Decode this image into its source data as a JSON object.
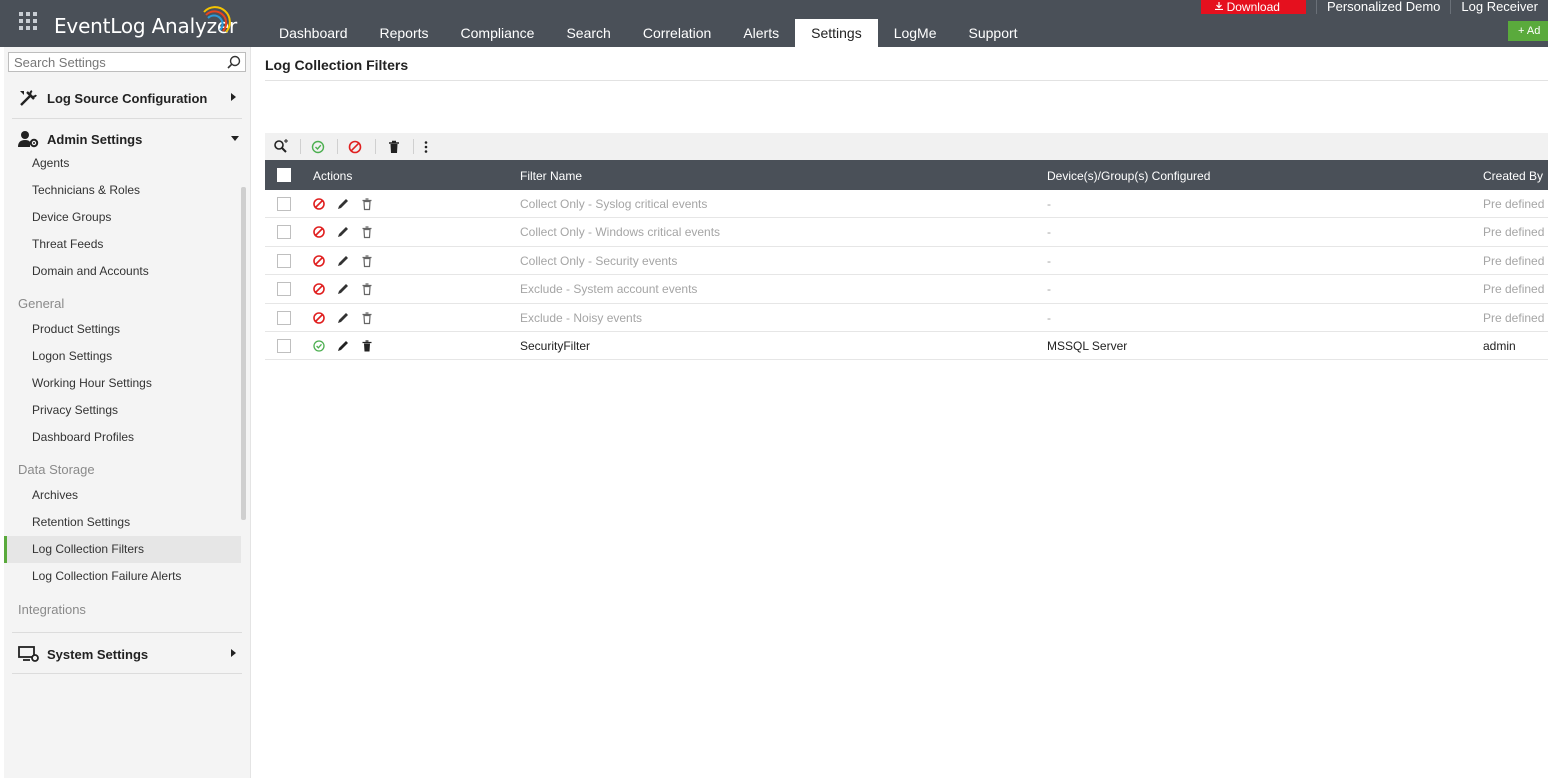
{
  "app": {
    "title": "EventLog Analyzer"
  },
  "nav": {
    "tabs": [
      {
        "label": "Dashboard"
      },
      {
        "label": "Reports"
      },
      {
        "label": "Compliance"
      },
      {
        "label": "Search"
      },
      {
        "label": "Correlation"
      },
      {
        "label": "Alerts"
      },
      {
        "label": "Settings"
      },
      {
        "label": "LogMe"
      },
      {
        "label": "Support"
      }
    ],
    "active": "Settings"
  },
  "top_right": {
    "download_label": "Download",
    "personalized_demo_label": "Personalized Demo",
    "log_receiver_label": "Log Receiver",
    "add_label": "+ Ad"
  },
  "sidebar": {
    "search_placeholder": "Search Settings",
    "sections": {
      "log_source": {
        "label": "Log Source Configuration"
      },
      "admin": {
        "label": "Admin Settings"
      },
      "system": {
        "label": "System Settings"
      }
    },
    "admin_items": [
      {
        "label": "Agents"
      },
      {
        "label": "Technicians & Roles"
      },
      {
        "label": "Device Groups"
      },
      {
        "label": "Threat Feeds"
      },
      {
        "label": "Domain and Accounts"
      }
    ],
    "general_label": "General",
    "general_items": [
      {
        "label": "Product Settings"
      },
      {
        "label": "Logon Settings"
      },
      {
        "label": "Working Hour Settings"
      },
      {
        "label": "Privacy Settings"
      },
      {
        "label": "Dashboard Profiles"
      }
    ],
    "data_storage_label": "Data Storage",
    "data_storage_items": [
      {
        "label": "Archives"
      },
      {
        "label": "Retention Settings"
      },
      {
        "label": "Log Collection Filters"
      },
      {
        "label": "Log Collection Failure Alerts"
      }
    ],
    "integrations_label": "Integrations",
    "active_item": "Log Collection Filters"
  },
  "main": {
    "title": "Log Collection Filters",
    "table": {
      "columns": {
        "actions": "Actions",
        "filter_name": "Filter Name",
        "devices": "Device(s)/Group(s) Configured",
        "created_by": "Created By"
      },
      "rows": [
        {
          "name": "Collect Only - Syslog critical events",
          "devices": "-",
          "created_by": "Pre defined",
          "status": "disabled"
        },
        {
          "name": "Collect Only - Windows critical events",
          "devices": "-",
          "created_by": "Pre defined",
          "status": "disabled"
        },
        {
          "name": "Collect Only - Security events",
          "devices": "-",
          "created_by": "Pre defined",
          "status": "disabled"
        },
        {
          "name": "Exclude - System account events",
          "devices": "-",
          "created_by": "Pre defined",
          "status": "disabled"
        },
        {
          "name": "Exclude - Noisy events",
          "devices": "-",
          "created_by": "Pre defined",
          "status": "disabled"
        },
        {
          "name": "SecurityFilter",
          "devices": "MSSQL Server",
          "created_by": "admin",
          "status": "enabled"
        }
      ]
    }
  },
  "colors": {
    "topbar": "#4a5058",
    "accent_green": "#5aaa3c",
    "download_red": "#e5101e",
    "disable_red": "#e02020",
    "enable_green": "#4caf50"
  }
}
